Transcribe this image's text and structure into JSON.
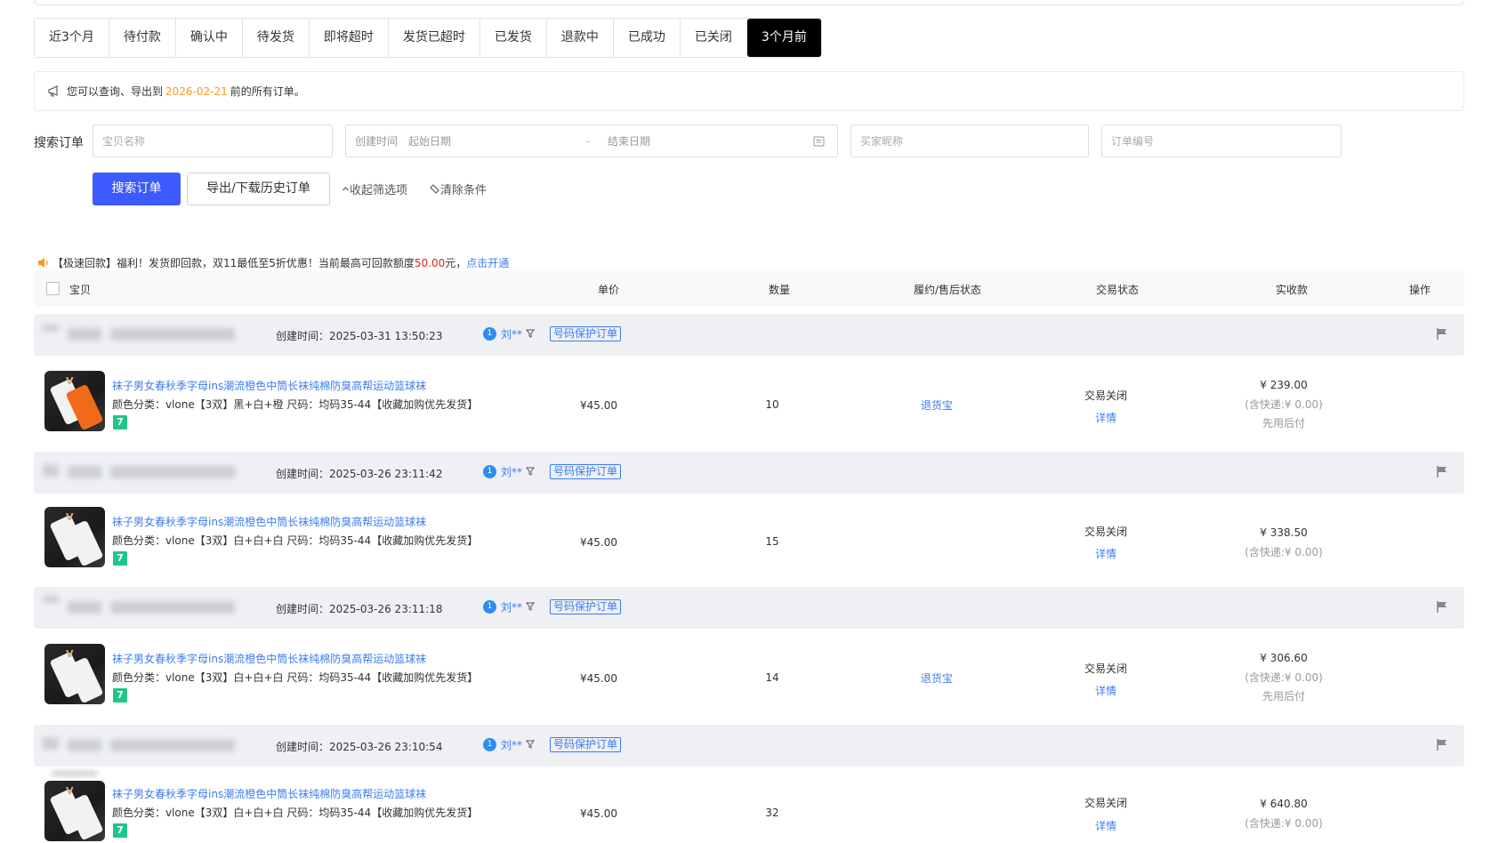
{
  "tabs": [
    {
      "label": "近3个月",
      "active": false
    },
    {
      "label": "待付款",
      "active": false
    },
    {
      "label": "确认中",
      "active": false
    },
    {
      "label": "待发货",
      "active": false
    },
    {
      "label": "即将超时",
      "active": false
    },
    {
      "label": "发货已超时",
      "active": false
    },
    {
      "label": "已发货",
      "active": false
    },
    {
      "label": "退款中",
      "active": false
    },
    {
      "label": "已成功",
      "active": false
    },
    {
      "label": "已关闭",
      "active": false
    },
    {
      "label": "3个月前",
      "active": true
    }
  ],
  "notice": {
    "prefix": "您可以查询、导出到",
    "date": "2026-02-21",
    "suffix": "前的所有订单。"
  },
  "search": {
    "label": "搜索订单",
    "item_placeholder": "宝贝名称",
    "created_label": "创建时间",
    "start_placeholder": "起始日期",
    "dash": "-",
    "end_placeholder": "结束日期",
    "buyer_placeholder": "买家昵称",
    "order_placeholder": "订单编号",
    "search_button": "搜索订单",
    "export_button": "导出/下载历史订单",
    "collapse_label": "收起筛选项",
    "clear_label": "清除条件"
  },
  "promo": {
    "prefix": "【极速回款】福利！发货即回款，双11最低至5折优惠！当前最高可回款额度",
    "amount": "50.00",
    "unit": "元，",
    "link": "点击开通"
  },
  "table_head": {
    "item": "宝贝",
    "unit_price": "单价",
    "quantity": "数量",
    "after_sale": "履约/售后状态",
    "trade_status": "交易状态",
    "received": "实收款",
    "action": "操作"
  },
  "orders": [
    {
      "created": "创建时间：2025-03-31 13:50:23",
      "buyer": "刘**",
      "buyer_badge": "1",
      "tag": "号码保护订单",
      "title": "袜子男女春秋季字母ins潮流橙色中筒长袜纯棉防臭高帮运动篮球袜",
      "spec": "颜色分类：vlone【3双】黑+白+橙   尺码：均码35-44【收藏加购优先发货】",
      "badge": "7",
      "price": "¥45.00",
      "qty": "10",
      "after_sale": "退货宝",
      "status": "交易关闭",
      "detail": "详情",
      "total": "¥ 239.00",
      "ship": "(含快递:¥ 0.00)",
      "pay_later": "先用后付"
    },
    {
      "created": "创建时间：2025-03-26 23:11:42",
      "buyer": "刘**",
      "buyer_badge": "1",
      "tag": "号码保护订单",
      "title": "袜子男女春秋季字母ins潮流橙色中筒长袜纯棉防臭高帮运动篮球袜",
      "spec": "颜色分类：vlone【3双】白+白+白   尺码：均码35-44【收藏加购优先发货】",
      "badge": "7",
      "price": "¥45.00",
      "qty": "15",
      "after_sale": "",
      "status": "交易关闭",
      "detail": "详情",
      "total": "¥ 338.50",
      "ship": "(含快递:¥ 0.00)",
      "pay_later": ""
    },
    {
      "created": "创建时间：2025-03-26 23:11:18",
      "buyer": "刘**",
      "buyer_badge": "1",
      "tag": "号码保护订单",
      "title": "袜子男女春秋季字母ins潮流橙色中筒长袜纯棉防臭高帮运动篮球袜",
      "spec": "颜色分类：vlone【3双】白+白+白   尺码：均码35-44【收藏加购优先发货】",
      "badge": "7",
      "price": "¥45.00",
      "qty": "14",
      "after_sale": "退货宝",
      "status": "交易关闭",
      "detail": "详情",
      "total": "¥ 306.60",
      "ship": "(含快递:¥ 0.00)",
      "pay_later": "先用后付"
    },
    {
      "created": "创建时间：2025-03-26 23:10:54",
      "buyer": "刘**",
      "buyer_badge": "1",
      "tag": "号码保护订单",
      "title": "袜子男女春秋季字母ins潮流橙色中筒长袜纯棉防臭高帮运动篮球袜",
      "spec": "颜色分类：vlone【3双】白+白+白   尺码：均码35-44【收藏加购优先发货】",
      "badge": "7",
      "price": "¥45.00",
      "qty": "32",
      "after_sale": "",
      "status": "交易关闭",
      "detail": "详情",
      "total": "¥ 640.80",
      "ship": "(含快递:¥ 0.00)",
      "pay_later": ""
    }
  ],
  "colors": {
    "accent": "#3d5afe",
    "link": "#3d7cf0",
    "date": "#f59a23",
    "amount": "#e02020",
    "badge": "#1fc68a"
  }
}
